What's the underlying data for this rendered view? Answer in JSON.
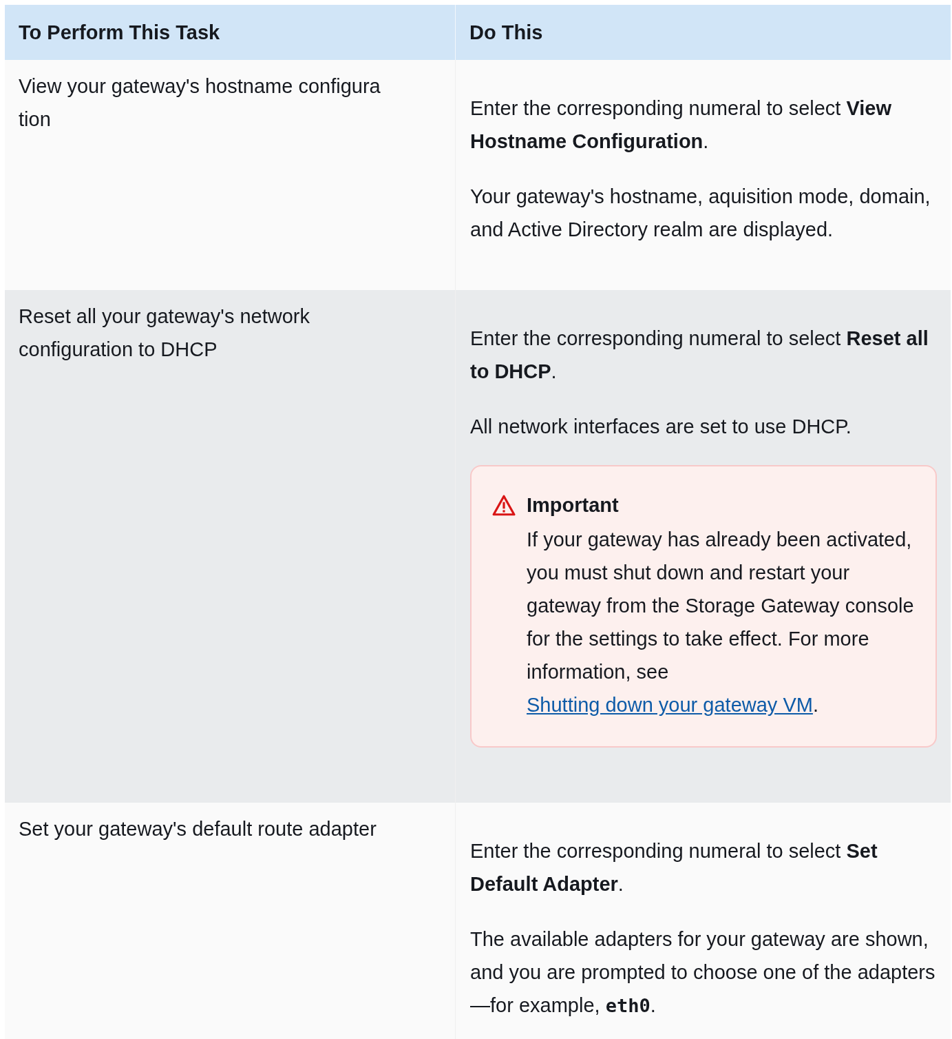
{
  "table": {
    "columns": [
      "To Perform This Task",
      "Do This"
    ],
    "rows": [
      {
        "task": [
          "View your gateway's hostname configura",
          "tion"
        ],
        "paragraphs": [
          [
            {
              "kind": "text",
              "text": "Enter the corresponding numeral to select "
            },
            {
              "kind": "bold",
              "text": "View  Hostname Configuration"
            },
            {
              "kind": "text",
              "text": "."
            }
          ],
          [
            {
              "kind": "text",
              "text": "Your gateway's hostname, aquisition mode, domain, and  Active Directory realm are displayed."
            }
          ]
        ]
      },
      {
        "task": [
          "Reset all your gateway's network",
          "configuration to  DHCP"
        ],
        "paragraphs": [
          [
            {
              "kind": "text",
              "text": "Enter the corresponding numeral to select "
            },
            {
              "kind": "bold",
              "text": "Reset  all to DHCP"
            },
            {
              "kind": "text",
              "text": "."
            }
          ],
          [
            {
              "kind": "text",
              "text": "All network interfaces are set to use DHCP."
            }
          ]
        ],
        "alert": {
          "kind": "important",
          "title": "Important",
          "body": [
            {
              "kind": "text",
              "text": "If your gateway has already been activated, you must  shut down and restart your gateway from the Storage Gateway   console for the settings to take effect. For more  information, see "
            },
            {
              "kind": "link",
              "text": "Shutting down your gateway VM"
            },
            {
              "kind": "text",
              "text": "."
            }
          ]
        }
      },
      {
        "task": [
          "Set your gateway's default route adapter"
        ],
        "paragraphs": [
          [
            {
              "kind": "text",
              "text": "Enter the corresponding numeral to select "
            },
            {
              "kind": "bold",
              "text": "Set  Default Adapter"
            },
            {
              "kind": "text",
              "text": "."
            }
          ],
          [
            {
              "kind": "text",
              "text": "The available adapters for your gateway are shown, and you  are prompted to choose one of the adapters—for  example, "
            },
            {
              "kind": "code",
              "text": "eth0"
            },
            {
              "kind": "text",
              "text": "."
            }
          ]
        ]
      }
    ]
  }
}
